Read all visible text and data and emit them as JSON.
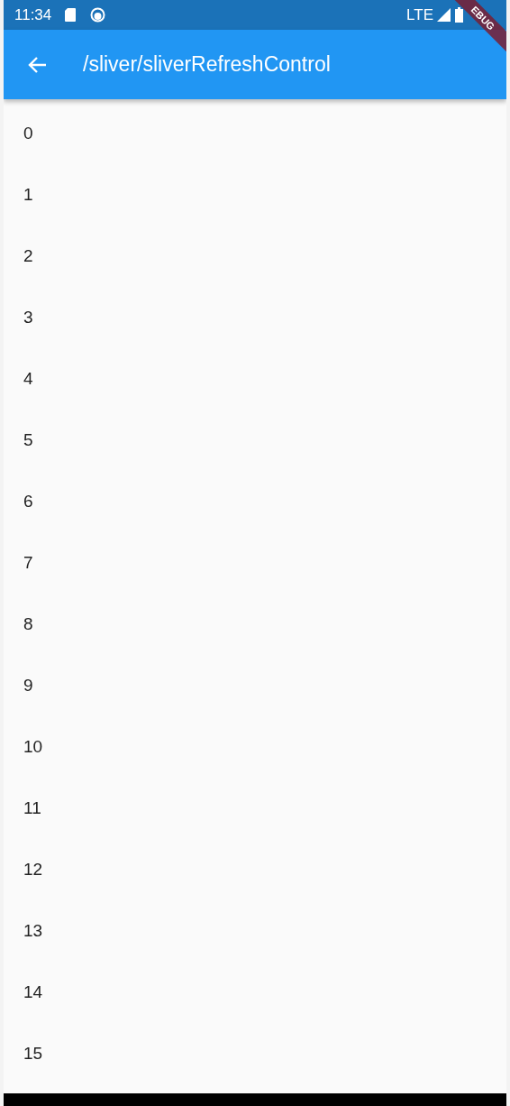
{
  "status_bar": {
    "time": "11:34",
    "network": "LTE"
  },
  "debug_banner": {
    "text": "EBUG"
  },
  "app_bar": {
    "title": "/sliver/sliverRefreshControl"
  },
  "list": {
    "items": [
      "0",
      "1",
      "2",
      "3",
      "4",
      "5",
      "6",
      "7",
      "8",
      "9",
      "10",
      "11",
      "12",
      "13",
      "14",
      "15"
    ]
  }
}
